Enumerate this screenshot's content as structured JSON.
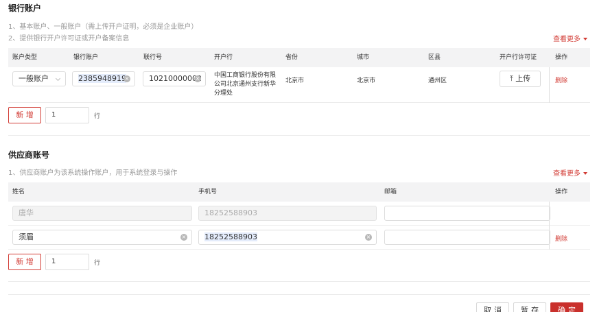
{
  "bank": {
    "title": "银行账户",
    "notes": [
      "1、基本账户、一般账户（需上传开户证明，必须是企业账户）",
      "2、提供银行开户许可证或开户备案信息"
    ],
    "more_label": "查看更多",
    "headers": [
      "账户类型",
      "银行账户",
      "联行号",
      "开户行",
      "省份",
      "城市",
      "区县",
      "开户行许可证",
      "操作"
    ],
    "row": {
      "account_type": "一般账户",
      "account_no": "2385948919",
      "bank_code": "10210000002",
      "bank_name": "中国工商银行股份有限公司北京通州支行新华分理处",
      "province": "北京市",
      "city": "北京市",
      "district": "通州区",
      "upload_label": "上传",
      "delete_label": "删除"
    },
    "add_label": "新 增",
    "add_count": "1",
    "unit": "行"
  },
  "supplier": {
    "title": "供应商账号",
    "note": "1、供应商账户为该系统操作账户，用于系统登录与操作",
    "more_label": "查看更多",
    "headers": [
      "姓名",
      "手机号",
      "邮箱",
      "操作"
    ],
    "rows": [
      {
        "name": "唐华",
        "phone": "18252588903",
        "email": ""
      },
      {
        "name": "须眉",
        "phone": "18252588903",
        "email": "",
        "delete_label": "删除"
      }
    ],
    "add_label": "新 增",
    "add_count": "1",
    "unit": "行"
  },
  "footer": {
    "cancel": "取消",
    "save": "暂存",
    "confirm": "确定"
  },
  "colors": {
    "accent": "#d23b34",
    "header_bg": "#f3f3f4"
  }
}
